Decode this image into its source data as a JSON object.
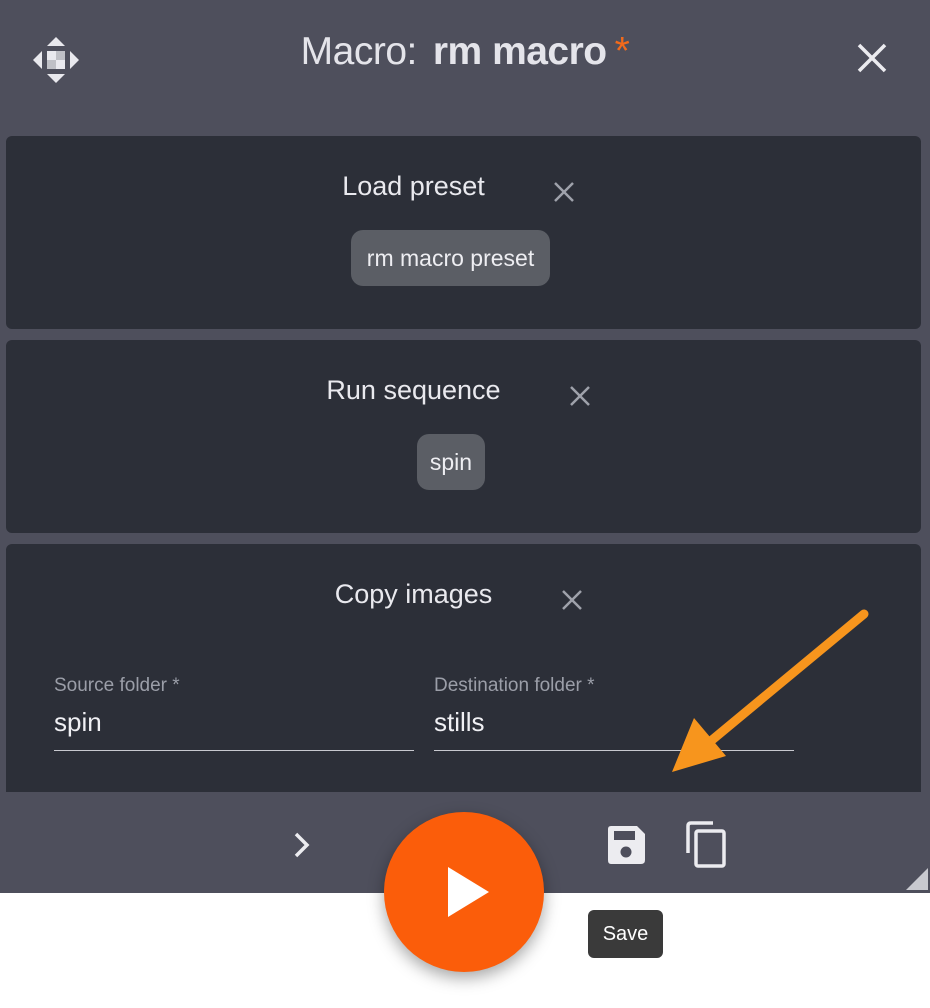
{
  "dialog": {
    "title_label": "Macro:",
    "title_name": "rm macro",
    "unsaved_marker": "*",
    "accent_color": "#f26a1b"
  },
  "steps": [
    {
      "title": "Load preset",
      "chip": "rm macro preset"
    },
    {
      "title": "Run sequence",
      "chip": "spin"
    },
    {
      "title": "Copy images",
      "source_label": "Source folder *",
      "source_value": "spin",
      "dest_label": "Destination folder *",
      "dest_value": "stills"
    }
  ],
  "footer": {
    "icons": [
      "chevron-right-icon",
      "save-icon",
      "copy-icon",
      "play-icon",
      "resize-handle-icon"
    ],
    "tooltip": "Save",
    "play_color": "#fb5d0a"
  },
  "annotation": {
    "arrow_color": "#f7951d"
  }
}
